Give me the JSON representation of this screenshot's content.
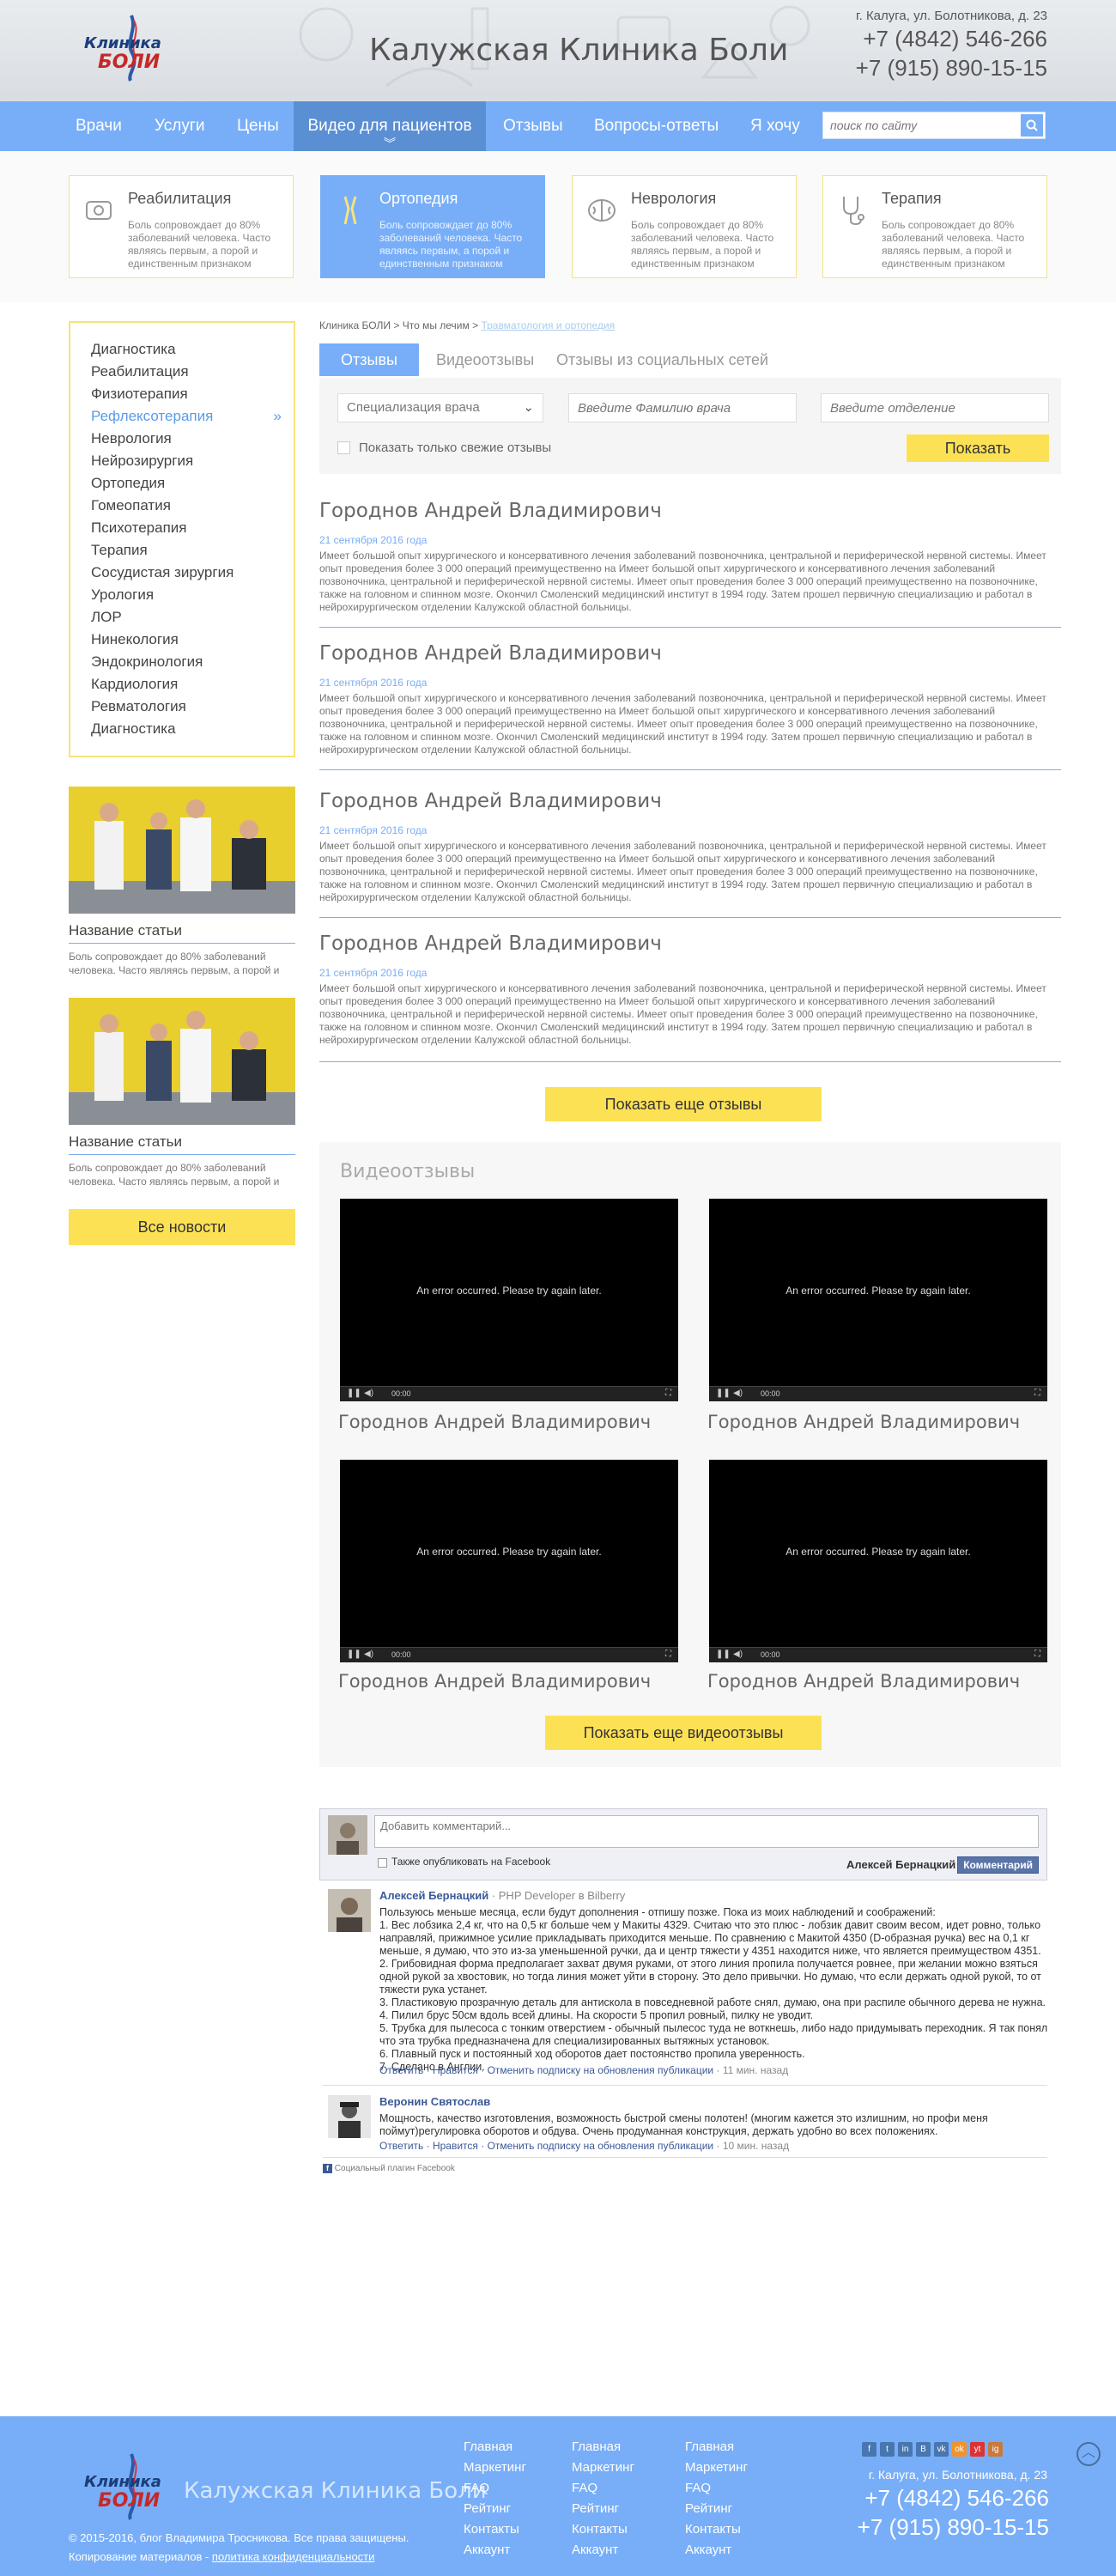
{
  "header": {
    "logo_line1": "Клиника",
    "logo_line2": "БОЛИ",
    "title": "Калужская Клиника Боли",
    "address": "г. Калуга, ул. Болотникова, д. 23",
    "phone1": "+7 (4842) 546-266",
    "phone2": "+7 (915) 890-15-15"
  },
  "nav": {
    "items": [
      "Врачи",
      "Услуги",
      "Цены",
      "Видео для пациентов",
      "Отзывы",
      "Вопросы-ответы",
      "Я хочу"
    ],
    "search_placeholder": "поиск по сайту"
  },
  "services": [
    {
      "title": "Реабилитация",
      "desc": "Боль сопровождает до 80% заболеваний человека. Часто являясь первым, а порой и единственным признаком"
    },
    {
      "title": "Ортопедия",
      "desc": "Боль сопровождает до 80% заболеваний человека. Часто являясь первым, а порой и единственным признаком"
    },
    {
      "title": "Неврология",
      "desc": "Боль сопровождает до 80% заболеваний человека. Часто являясь первым, а порой и единственным признаком"
    },
    {
      "title": "Терапия",
      "desc": "Боль сопровождает до 80% заболеваний человека. Часто являясь первым, а порой и единственным признаком"
    }
  ],
  "sidebar": {
    "items": [
      "Диагностика",
      "Реабилитация",
      "Физиотерапия",
      "Рефлексотерапия",
      "Неврология",
      "Нейрозирургия",
      "Ортопедия",
      "Гомеопатия",
      "Психотерапия",
      "Терапия",
      "Сосудистая зирургия",
      "Урология",
      "ЛОР",
      "Нинекология",
      "Эндокринология",
      "Кардиология",
      "Ревматология",
      "Диагностика"
    ],
    "articles": [
      {
        "title": "Название статьи",
        "desc": "Боль сопровождает до 80% заболеваний человека. Часто являясь первым, а порой и"
      },
      {
        "title": "Название статьи",
        "desc": "Боль сопровождает до 80% заболеваний человека. Часто являясь первым, а порой и"
      }
    ],
    "all_news": "Все новости"
  },
  "breadcrumb": {
    "home": "Клиника БОЛИ",
    "sep": ">",
    "section": "Что мы лечим",
    "current": "Травматология и ортопедия"
  },
  "tabs": [
    "Отзывы",
    "Видеоотзывы",
    "Отзывы из социальных сетей"
  ],
  "filter": {
    "specialization": "Специализация врача",
    "doctor_placeholder": "Введите Фамилию врача",
    "department_placeholder": "Введите отделение",
    "fresh_only": "Показать только свежие отзывы",
    "show": "Показать"
  },
  "reviews": [
    {
      "name": "Городнов Андрей Владимирович",
      "date": "21 сентября 2016 года",
      "text": "Имеет большой опыт хирургического и консервативного лечения заболеваний позвоночника, центральной и периферической нервной системы. Имеет опыт проведения более 3 000 операций преимущественно на Имеет большой опыт хирургического и консервативного лечения заболеваний позвоночника, центральной и периферической нервной системы. Имеет опыт проведения более 3 000 операций преимущественно на позвоночнике, также на головном и спинном мозге. Окончил Смоленский медицинский институт в 1994 году. Затем прошел первичную специализацию и работал в нейрохирургическом отделении  Калужской областной больницы."
    },
    {
      "name": "Городнов Андрей Владимирович",
      "date": "21 сентября 2016 года",
      "text": "Имеет большой опыт хирургического и консервативного лечения заболеваний позвоночника, центральной и периферической нервной системы. Имеет опыт проведения более 3 000 операций преимущественно на Имеет большой опыт хирургического и консервативного лечения заболеваний позвоночника, центральной и периферической нервной системы. Имеет опыт проведения более 3 000 операций преимущественно на позвоночнике, также на головном и спинном мозге. Окончил Смоленский медицинский институт в 1994 году. Затем прошел первичную специализацию и работал в нейрохирургическом отделении  Калужской областной больницы."
    },
    {
      "name": "Городнов Андрей Владимирович",
      "date": "21 сентября 2016 года",
      "text": "Имеет большой опыт хирургического и консервативного лечения заболеваний позвоночника, центральной и периферической нервной системы. Имеет опыт проведения более 3 000 операций преимущественно на Имеет большой опыт хирургического и консервативного лечения заболеваний позвоночника, центральной и периферической нервной системы. Имеет опыт проведения более 3 000 операций преимущественно на позвоночнике, также на головном и спинном мозге. Окончил Смоленский медицинский институт в 1994 году. Затем прошел первичную специализацию и работал в нейрохирургическом отделении  Калужской областной больницы."
    },
    {
      "name": "Городнов Андрей Владимирович",
      "date": "21 сентября 2016 года",
      "text": "Имеет большой опыт хирургического и консервативного лечения заболеваний позвоночника, центральной и периферической нервной системы. Имеет опыт проведения более 3 000 операций преимущественно на Имеет большой опыт хирургического и консервативного лечения заболеваний позвоночника, центральной и периферической нервной системы. Имеет опыт проведения более 3 000 операций преимущественно на позвоночнике, также на головном и спинном мозге. Окончил Смоленский медицинский институт в 1994 году. Затем прошел первичную специализацию и работал в нейрохирургическом отделении  Калужской областной больницы."
    }
  ],
  "more_reviews": "Показать еще отзывы",
  "videos": {
    "heading": "Видеоотзывы",
    "error": "An error occurred. Please try again later.",
    "time": "00:00",
    "names": [
      "Городнов Андрей Владимирович",
      "Городнов Андрей Владимирович",
      "Городнов Андрей Владимирович",
      "Городнов Андрей Владимирович"
    ],
    "more": "Показать еще видеоотзывы"
  },
  "comments": {
    "placeholder": "Добавить комментарий...",
    "also_post": "Также опубликовать на Facebook",
    "user": "Алексей Бернацкий",
    "post_btn": "Комментарий",
    "items": [
      {
        "author": "Алексей Бернацкий",
        "subtitle": "· PHP Developer в Bilberry",
        "lines": [
          "Пользуюсь меньше месяца, если будут дополнения - отпишу позже. Пока из моих наблюдений и соображений:",
          "1. Вес лобзика 2,4 кг, что на 0,5 кг больше чем у Макиты 4329. Считаю что это плюс - лобзик давит своим весом, идет ровно, только",
          "направляй, прижимное усилие прикладывать приходится меньше. По сравнению с Макитой 4350 (D-образная ручка) вес на 0,1 кг",
          "меньше, я думаю, что это из-за уменьшенной ручки, да и центр тяжести у 4351 находится ниже, что является преимуществом 4351.",
          "2. Грибовидная форма предполагает захват двумя руками, от этого линия пропила получается ровнее, при желании можно взяться",
          "одной рукой за хвостовик, но тогда линия может уйти в сторону. Это дело привычки. Но думаю, что если держать одной рукой, то от",
          "тяжести рука устанет.",
          "3. Пластиковую прозрачную деталь для антискола в повседневной работе снял, думаю, она при распиле обычного дерева не нужна.",
          "4. Пилил брус 50см вдоль всей длины. На скорости 5 пропил ровный, пилку не уводит.",
          "5. Трубка для пылесоса с тонким отверстием - обычный пылесос туда не воткнешь, либо надо придумывать переходник. Я так понял",
          "что эта трубка предназначена для специализированных вытяжных установок.",
          "6. Плавный пуск и постоянный ход оборотов дает постоянство пропила уверенность.",
          "7. Сделано в Англии."
        ],
        "actions": "Ответить · Нравится · Отменить подписку на обновления публикации",
        "time": "· 11 мин. назад"
      },
      {
        "author": "Веронин Святослав",
        "subtitle": "",
        "lines": [
          "Мощность, качество изготовления, возможность быстрой смены полотен! (многим кажется это излишним, но профи меня",
          "поймут)регулировка оборотов и обдува. Очень продуманная конструкция, держать удобно во всех положениях."
        ],
        "actions": "Ответить · Нравится · Отменить подписку на обновления публикации",
        "time": "· 10 мин. назад"
      }
    ],
    "plugin": "Социальный плагин Facebook"
  },
  "footer": {
    "title": "Калужская Клиника Боли",
    "copyright": "© 2015-2016, блог Владимира Тросникова. Все права защищены.",
    "copy_notice": "Копирование материалов -",
    "privacy": "политика конфиденциальности",
    "cols": [
      [
        "Главная",
        "Маркетинг",
        "FAQ",
        "Рейтинг",
        "Контакты",
        "Аккаунт"
      ],
      [
        "Главная",
        "Маркетинг",
        "FAQ",
        "Рейтинг",
        "Контакты",
        "Аккаунт"
      ],
      [
        "Главная",
        "Маркетинг",
        "FAQ",
        "Рейтинг",
        "Контакты",
        "Аккаунт"
      ]
    ],
    "address": "г. Калуга, ул. Болотникова, д. 23",
    "phone1": "+7 (4842) 546-266",
    "phone2": "+7 (915) 890-15-15",
    "social": [
      "f",
      "t",
      "in",
      "B",
      "vk",
      "ok",
      "yt",
      "ig"
    ]
  }
}
